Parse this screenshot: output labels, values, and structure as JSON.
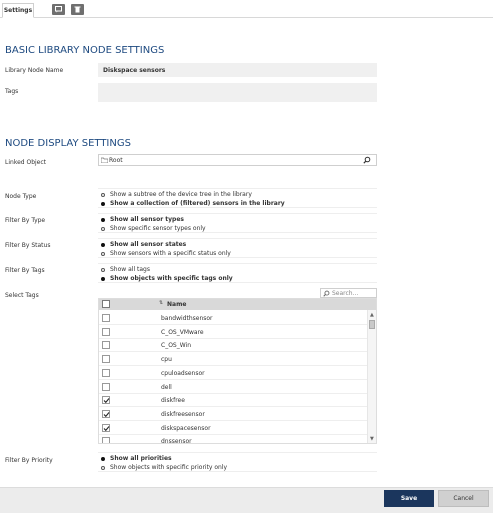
{
  "tabs": {
    "settings_label": "Settings",
    "icon_1": "comment-icon",
    "icon_2": "trash-icon"
  },
  "basic_section": {
    "title": "BASIC LIBRARY NODE SETTINGS",
    "library_node_name_label": "Library Node Name",
    "library_node_name_value": "Diskspace sensors",
    "tags_label": "Tags",
    "tags_value": ""
  },
  "display_section": {
    "title": "NODE DISPLAY SETTINGS",
    "linked_object_label": "Linked Object",
    "linked_object_value": "Root",
    "node_type": {
      "label": "Node Type",
      "options": [
        "Show a subtree of the device tree in the library",
        "Show a collection of (filtered) sensors in the library"
      ],
      "selected": 1
    },
    "filter_by_type": {
      "label": "Filter By Type",
      "options": [
        "Show all sensor types",
        "Show specific sensor types only"
      ],
      "selected": 0
    },
    "filter_by_status": {
      "label": "Filter By Status",
      "options": [
        "Show all sensor states",
        "Show sensors with a specific status only"
      ],
      "selected": 0
    },
    "filter_by_tags": {
      "label": "Filter By Tags",
      "options": [
        "Show all tags",
        "Show objects with specific tags only"
      ],
      "selected": 1
    },
    "select_tags": {
      "label": "Select Tags",
      "search_placeholder": "Search...",
      "column_name": "Name",
      "rows": [
        {
          "name": "bandwidthsensor",
          "checked": false
        },
        {
          "name": "C_OS_VMware",
          "checked": false
        },
        {
          "name": "C_OS_Win",
          "checked": false
        },
        {
          "name": "cpu",
          "checked": false
        },
        {
          "name": "cpuloadsensor",
          "checked": false
        },
        {
          "name": "dell",
          "checked": false
        },
        {
          "name": "diskfree",
          "checked": true
        },
        {
          "name": "diskfreesensor",
          "checked": true
        },
        {
          "name": "diskspacesensor",
          "checked": true
        },
        {
          "name": "dnssensor",
          "checked": false
        }
      ]
    },
    "filter_by_priority": {
      "label": "Filter By Priority",
      "options": [
        "Show all priorities",
        "Show objects with specific priority only"
      ],
      "selected": 0
    }
  },
  "footer": {
    "save_label": "Save",
    "cancel_label": "Cancel"
  },
  "colors": {
    "accent": "#1e4a80",
    "save_button": "#1b365d"
  }
}
